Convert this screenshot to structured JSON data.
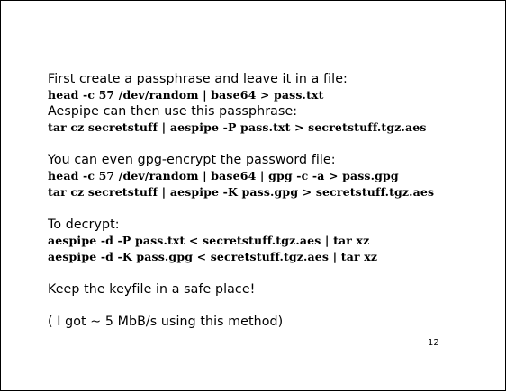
{
  "slide": {
    "section1": {
      "intro": "First create a passphrase and leave it in a file:",
      "cmd1": "head -c 57 /dev/random | base64 > pass.txt",
      "note": "Aespipe can then use this passphrase:",
      "cmd2": "tar cz secretstuff | aespipe -P pass.txt > secretstuff.tgz.aes"
    },
    "section2": {
      "intro": "You can even gpg-encrypt the password file:",
      "cmd1": "head -c 57 /dev/random | base64 | gpg -c -a > pass.gpg",
      "cmd2": "tar cz secretstuff | aespipe -K pass.gpg > secretstuff.tgz.aes"
    },
    "section3": {
      "intro": "To decrypt:",
      "cmd1": "aespipe -d -P pass.txt < secretstuff.tgz.aes | tar xz",
      "cmd2": "aespipe -d -K pass.gpg < secretstuff.tgz.aes | tar xz"
    },
    "section4": {
      "text": "Keep the keyfile in a safe place!"
    },
    "section5": {
      "text": "( I got ∼ 5 MbB/s using this method)"
    },
    "page_number": "12"
  }
}
